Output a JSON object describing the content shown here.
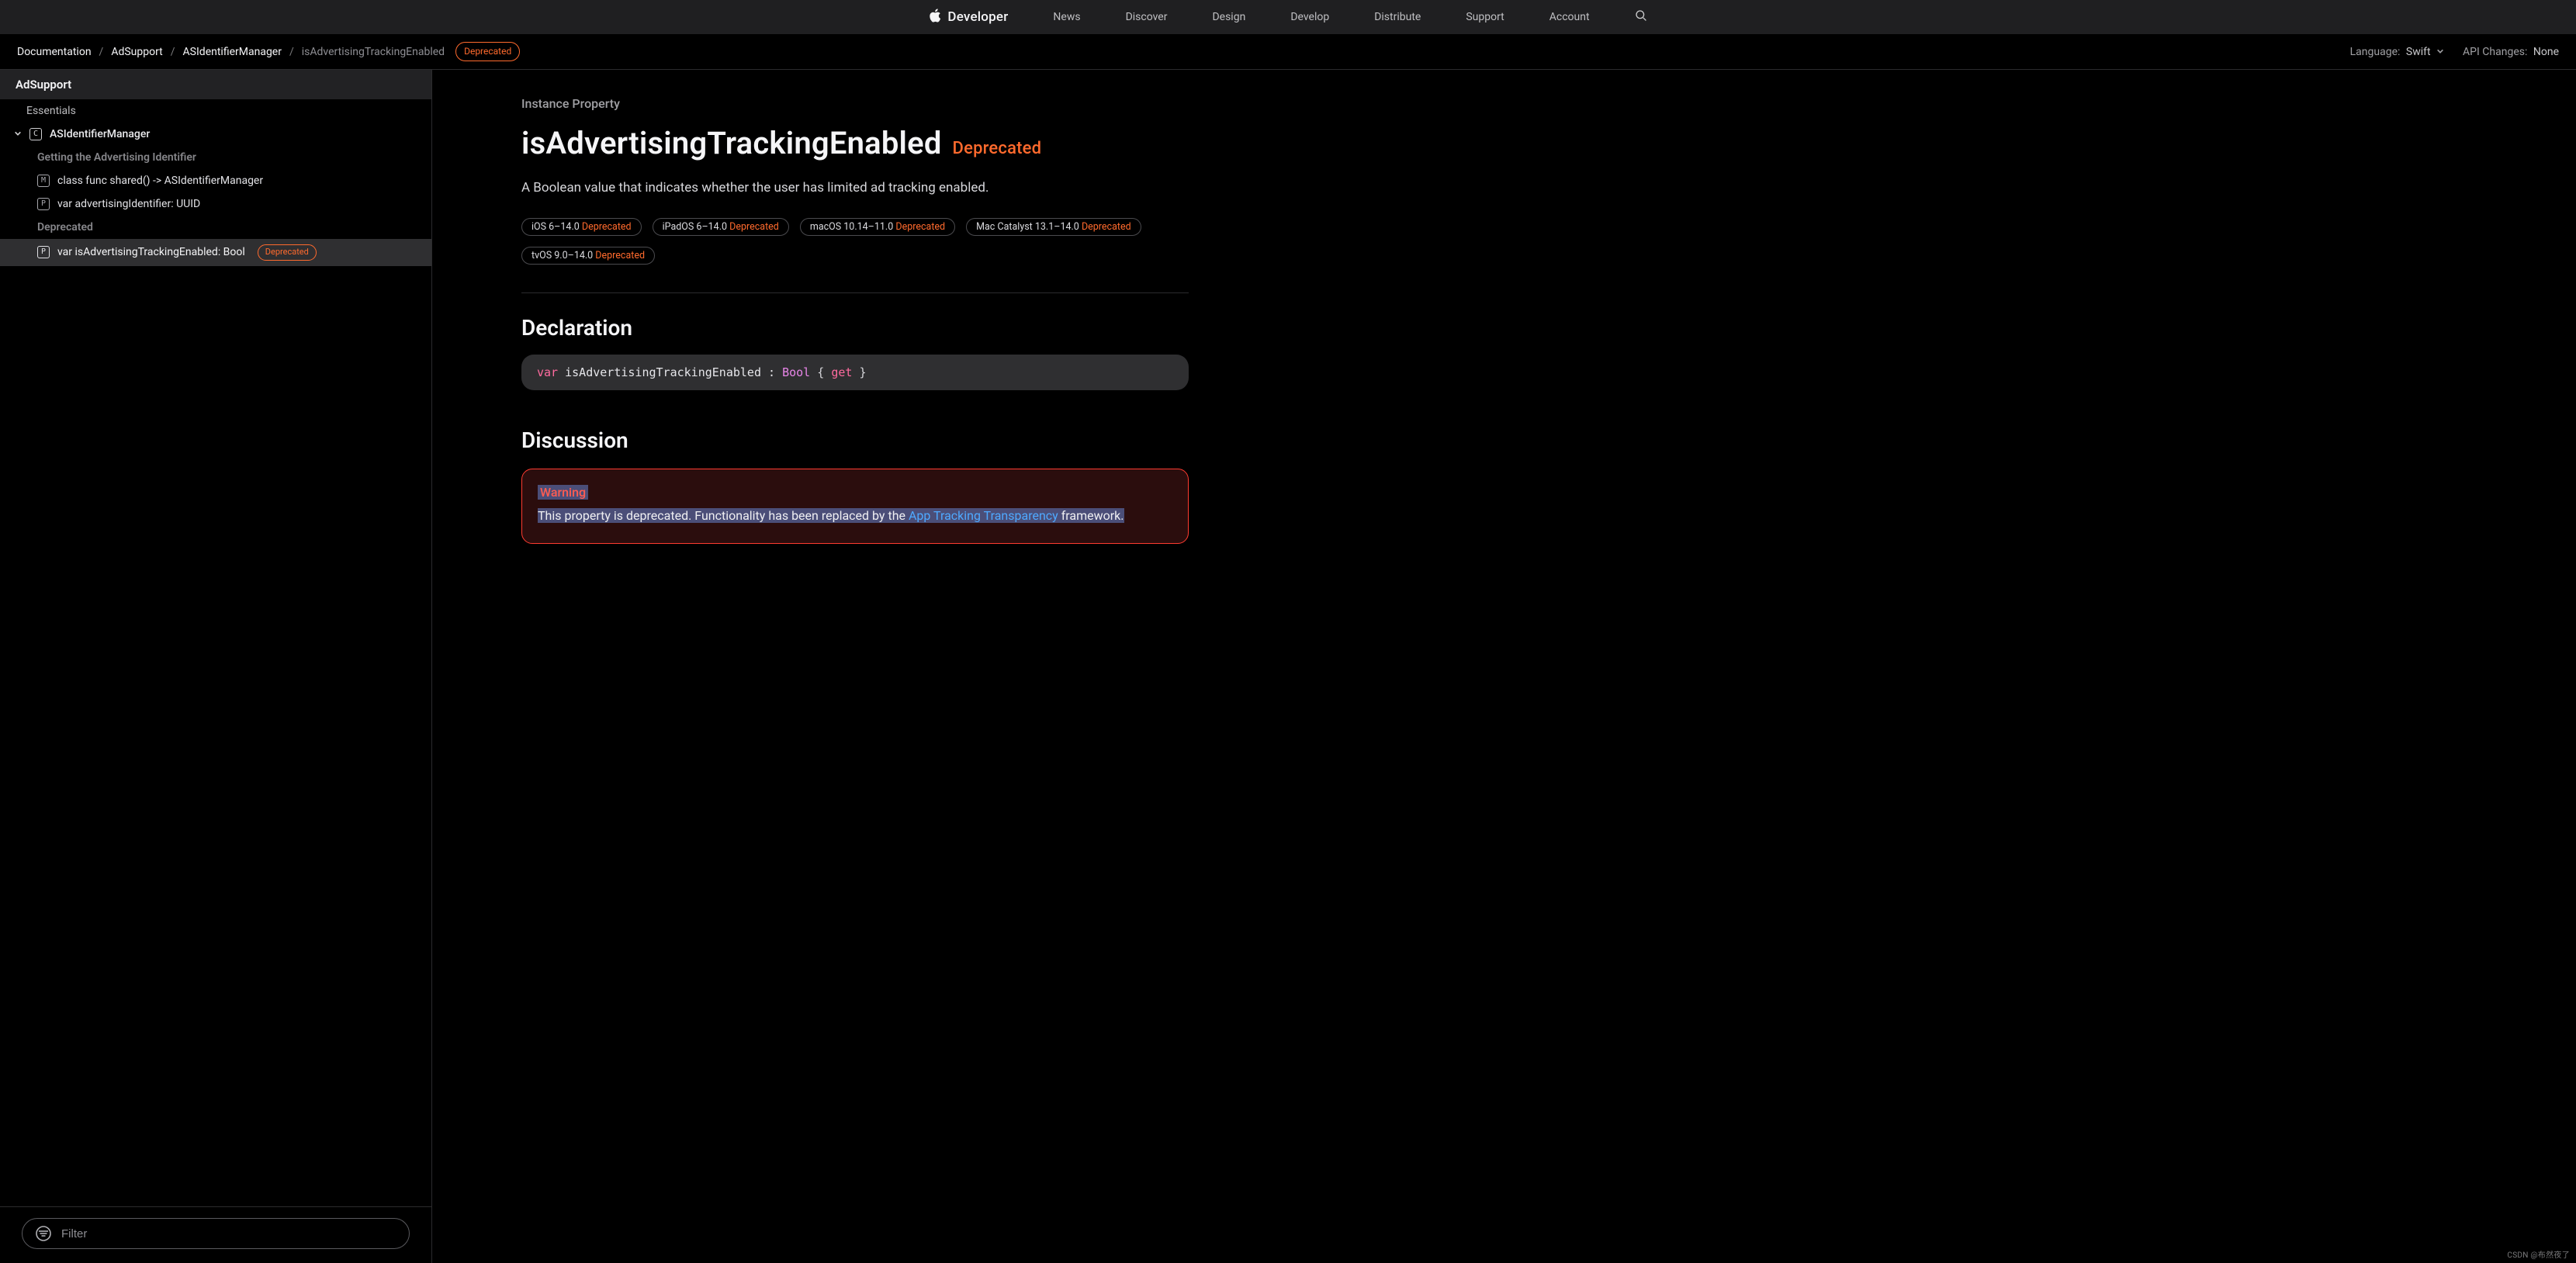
{
  "topnav": {
    "brand": "Developer",
    "links": [
      "News",
      "Discover",
      "Design",
      "Develop",
      "Distribute",
      "Support",
      "Account"
    ]
  },
  "breadcrumb": {
    "items": [
      "Documentation",
      "AdSupport",
      "ASIdentifierManager"
    ],
    "current": "isAdvertisingTrackingEnabled",
    "badge": "Deprecated"
  },
  "subbar": {
    "lang_label": "Language:",
    "lang_value": "Swift",
    "api_label": "API Changes:",
    "api_value": "None"
  },
  "sidebar": {
    "title": "AdSupport",
    "essentials": "Essentials",
    "root": {
      "symbol": "C",
      "label": "ASIdentifierManager"
    },
    "section_getting": "Getting the Advertising Identifier",
    "leaf_shared": {
      "symbol": "M",
      "label": "class func shared() -> ASIdentifierManager"
    },
    "leaf_advid": {
      "symbol": "P",
      "label": "var advertisingIdentifier: UUID"
    },
    "section_dep": "Deprecated",
    "leaf_isadv": {
      "symbol": "P",
      "label": "var isAdvertisingTrackingEnabled: Bool",
      "dep": "Deprecated"
    },
    "filter_placeholder": "Filter"
  },
  "page": {
    "kicker": "Instance Property",
    "title": "isAdvertisingTrackingEnabled",
    "title_dep": "Deprecated",
    "summary": "A Boolean value that indicates whether the user has limited ad tracking enabled.",
    "platforms": [
      {
        "os": "iOS 6–14.0",
        "dep": "Deprecated"
      },
      {
        "os": "iPadOS 6–14.0",
        "dep": "Deprecated"
      },
      {
        "os": "macOS 10.14–11.0",
        "dep": "Deprecated"
      },
      {
        "os": "Mac Catalyst 13.1–14.0",
        "dep": "Deprecated"
      },
      {
        "os": "tvOS 9.0–14.0",
        "dep": "Deprecated"
      }
    ],
    "decl_heading": "Declaration",
    "decl": {
      "kw_var": "var",
      "name": "isAdvertisingTrackingEnabled",
      "colon": ": ",
      "type": "Bool",
      "open": " { ",
      "kw_get": "get",
      "close": " }"
    },
    "disc_heading": "Discussion",
    "warn": {
      "title": "Warning",
      "body_a": "This property is deprecated. Functionality has been replaced by the ",
      "link": "App Tracking Transparency",
      "body_b": " framework."
    }
  },
  "watermark": "CSDN @布然夜了"
}
